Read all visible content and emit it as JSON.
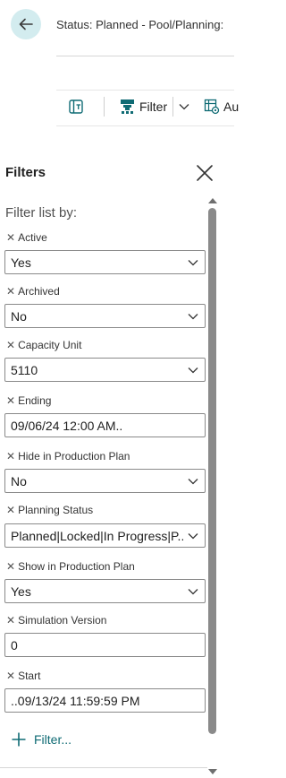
{
  "header": {
    "status_title": "Status: Planned - Pool/Planning:"
  },
  "action_bar": {
    "filter_label": "Filter",
    "auto_label": "Au"
  },
  "filter_pane": {
    "title": "Filters",
    "filter_list_by": "Filter list by:",
    "filters": [
      {
        "label": "Active",
        "value": "Yes",
        "type": "select"
      },
      {
        "label": "Archived",
        "value": "No",
        "type": "select"
      },
      {
        "label": "Capacity Unit",
        "value": "5110",
        "type": "select"
      },
      {
        "label": "Ending",
        "value": "09/06/24 12:00 AM..",
        "type": "text"
      },
      {
        "label": "Hide in Production Plan",
        "value": "No",
        "type": "select"
      },
      {
        "label": "Planning Status",
        "value": "Planned|Locked|In Progress|P...",
        "type": "select"
      },
      {
        "label": "Show in Production Plan",
        "value": "Yes",
        "type": "select"
      },
      {
        "label": "Simulation Version",
        "value": "0",
        "type": "text"
      },
      {
        "label": "Start",
        "value": "..09/13/24 11:59:59 PM",
        "type": "text"
      }
    ],
    "add_filter_label": "Filter...",
    "remove_glyph": "✕"
  },
  "colors": {
    "accent": "#0f6b74",
    "back_button_bg": "#d3ecef",
    "scrollbar": "#8a8a8a"
  }
}
